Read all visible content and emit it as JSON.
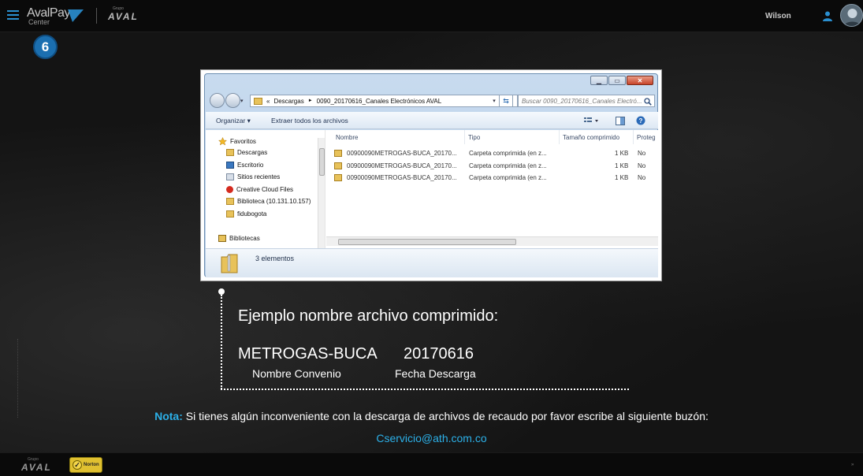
{
  "header": {
    "logo_main": "AvalPay",
    "logo_sub": "Center",
    "grupo_small": "Grupo",
    "grupo_name": "AVAL",
    "username": "Wilson"
  },
  "step": {
    "number": "6"
  },
  "explorer": {
    "address_prefix": "«",
    "address_path_1": "Descargas",
    "address_sep": "►",
    "address_path_2": "0090_20170616_Canales Electrónicos AVAL",
    "search_placeholder": "Buscar 0090_20170616_Canales Electró...",
    "toolbar": {
      "organize": "Organizar ▾",
      "extract_all": "Extraer todos los archivos"
    },
    "nav": {
      "favoritos": "Favoritos",
      "descargas": "Descargas",
      "escritorio": "Escritorio",
      "recientes": "Sitios recientes",
      "creative_cloud": "Creative Cloud Files",
      "biblioteca_ip": "Biblioteca (10.131.10.157)",
      "fidubogota": "fidubogota",
      "bibliotecas": "Bibliotecas"
    },
    "columns": {
      "name": "Nombre",
      "type": "Tipo",
      "size": "Tamaño comprimido",
      "protected": "Proteg"
    },
    "files": [
      {
        "name": "00900090METROGAS-BUCA_20170...",
        "type": "Carpeta comprimida (en z...",
        "size": "1 KB",
        "protected": "No"
      },
      {
        "name": "00900090METROGAS-BUCA_20170...",
        "type": "Carpeta comprimida (en z...",
        "size": "1 KB",
        "protected": "No"
      },
      {
        "name": "00900090METROGAS-BUCA_20170...",
        "type": "Carpeta comprimida (en z...",
        "size": "1 KB",
        "protected": "No"
      }
    ],
    "details_count": "3 elementos"
  },
  "example": {
    "title": "Ejemplo nombre archivo comprimido:",
    "name_value": "METROGAS-BUCA",
    "date_value": "20170616",
    "name_label": "Nombre Convenio",
    "date_label": "Fecha Descarga"
  },
  "note": {
    "prefix": "Nota:",
    "text": " Si tienes algún inconveniente con la descarga de archivos de recaudo por favor escribe al siguiente buzón:",
    "email": "Cservicio@ath.com.co"
  },
  "footer": {
    "grupo_small": "Grupo",
    "grupo_name": "AVAL",
    "norton_label": "Norton",
    "arrows": "»"
  },
  "colors": {
    "accent": "#2cb0e8",
    "step_badge": "#1b6fb0",
    "background": "#141414"
  }
}
